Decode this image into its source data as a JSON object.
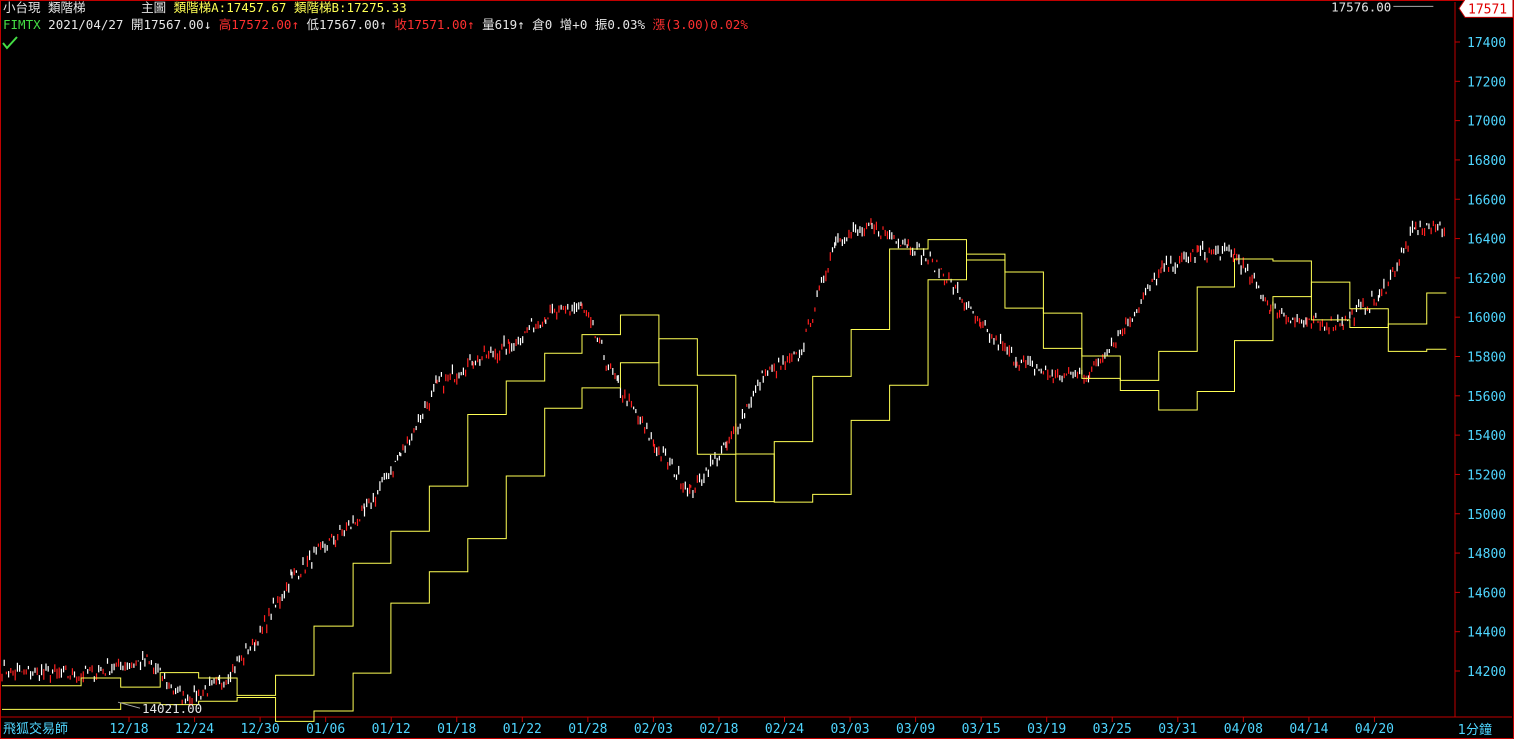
{
  "header": {
    "symbol_name": "小台現",
    "indicator_name": "類階梯",
    "panel_label": "主圖",
    "ladder_a": "類階梯A:17457.67",
    "ladder_b": "類階梯B:17275.33",
    "code": "FIMTX",
    "date": "2021/04/27",
    "open": "開17567.00",
    "open_arrow": "↓",
    "high": "高17572.00",
    "high_arrow": "↑",
    "low": "低17567.00",
    "low_arrow": "↑",
    "close": "收17571.00",
    "close_arrow": "↑",
    "volume": "量619",
    "volume_arrow": "↑",
    "oi": "倉0",
    "oi_change": "增+0",
    "amplitude": "振0.03%",
    "change": "漲(3.00)0.02%"
  },
  "branding": "飛狐交易師",
  "time_unit": "1分鐘",
  "colors": {
    "background": "#000000",
    "frame": "#c00000",
    "ladder": "#ffff55",
    "up": "#ff2020",
    "down": "#ffffff",
    "axis_text": "#4fd6ff"
  },
  "chart_data": {
    "type": "candlestick",
    "x_ticks": [
      "12/18",
      "12/24",
      "12/30",
      "01/06",
      "01/12",
      "01/18",
      "01/22",
      "01/28",
      "02/03",
      "02/18",
      "02/24",
      "03/03",
      "03/09",
      "03/15",
      "03/19",
      "03/25",
      "03/31",
      "04/08",
      "04/14",
      "04/20"
    ],
    "y_ticks": [
      14200,
      14400,
      14600,
      14800,
      15000,
      15200,
      15400,
      15600,
      15800,
      16000,
      16200,
      16400,
      16600,
      16800,
      17000,
      17200,
      17400
    ],
    "ylim": [
      14021,
      17590
    ],
    "min_label": "14021.00",
    "max_label": "17576.00",
    "last_price_label": "17571",
    "series": [
      {
        "name": "類階梯A",
        "color": "#ffff55"
      },
      {
        "name": "類階梯B",
        "color": "#ffff55"
      }
    ],
    "price_path_x_index": [
      0,
      1,
      2,
      2.5,
      3,
      3.5,
      4,
      4.6,
      5,
      5.5,
      6,
      6.5,
      7,
      7.5,
      8,
      8.5,
      9,
      9.5,
      10,
      10.5,
      11,
      11.5,
      12,
      12.5,
      13,
      13.5,
      14,
      14.5,
      15,
      15.5,
      16,
      16.5,
      17,
      17.5,
      18,
      18.5,
      19,
      19.5,
      19.9
    ],
    "price_path_close": [
      14200,
      14180,
      14250,
      14060,
      14130,
      14350,
      14680,
      14880,
      15000,
      15300,
      15650,
      15780,
      15850,
      16010,
      16050,
      15650,
      15350,
      15110,
      15350,
      15700,
      15800,
      16400,
      16450,
      16380,
      16220,
      15950,
      15780,
      15700,
      15720,
      15960,
      16240,
      16330,
      16320,
      16050,
      15960,
      15980,
      16100,
      16450,
      16460
    ]
  }
}
